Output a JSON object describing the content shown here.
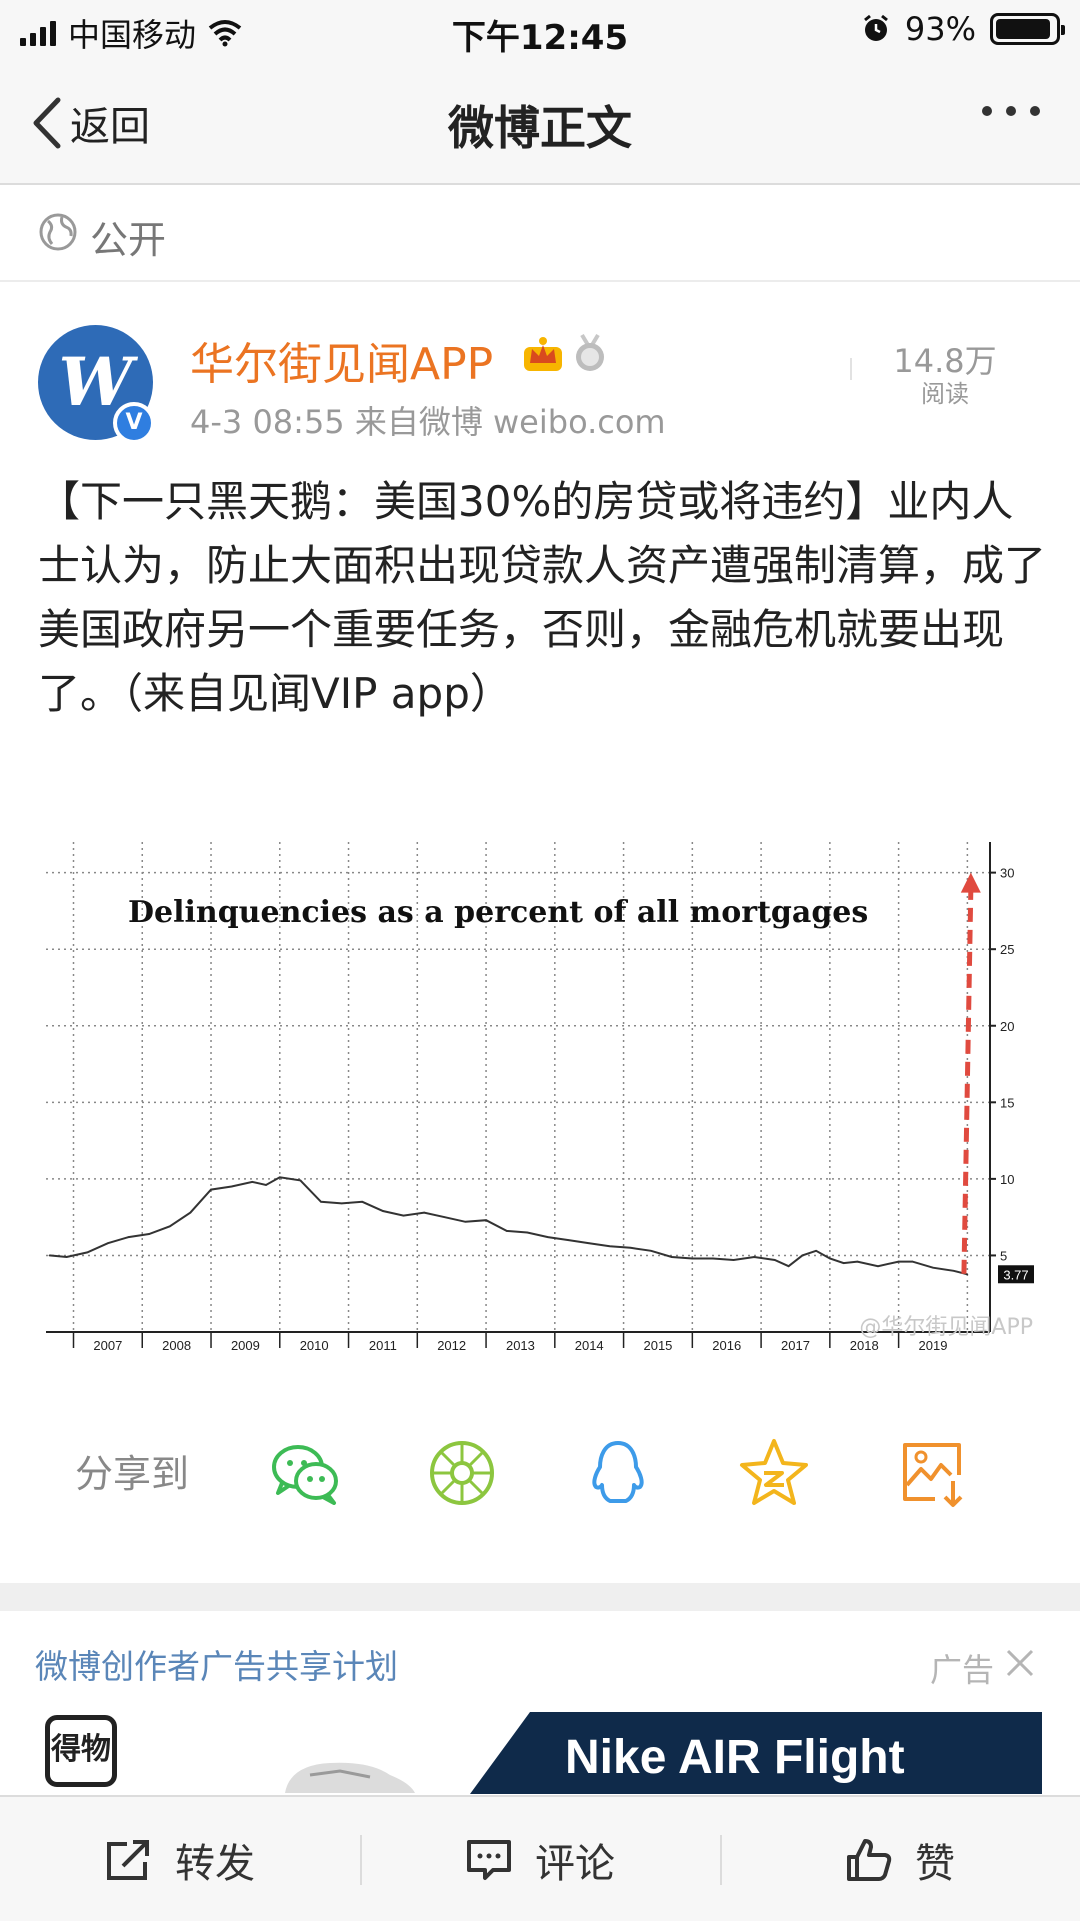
{
  "status_bar": {
    "carrier": "中国移动",
    "time": "下午12:45",
    "battery_text": "93%",
    "battery_level": 0.93
  },
  "nav": {
    "back_label": "返回",
    "title": "微博正文"
  },
  "post": {
    "visibility": "公开",
    "author": "华尔街见闻APP",
    "avatar_text": "W",
    "meta": "4-3 08:55  来自微博 weibo.com",
    "read_count": "14.8万",
    "read_label": "阅读",
    "text": "【下一只黑天鹅：美国30%的房贷或将违约】业内人士认为，防止大面积出现贷款人资产遭强制清算，成了美国政府另一个重要任务，否则，金融危机就要出现了。（来自见闻VIP app）",
    "watermark": "@华尔街见闻APP"
  },
  "chart_data": {
    "type": "line",
    "title": "Delinquencies as a percent of  all mortgages",
    "x_tick_labels": [
      "2007",
      "2008",
      "2009",
      "2010",
      "2011",
      "2012",
      "2013",
      "2014",
      "2015",
      "2016",
      "2017",
      "2018",
      "2019"
    ],
    "y_tick_labels": [
      "5",
      "10",
      "15",
      "20",
      "25",
      "30"
    ],
    "ylim": [
      0,
      32
    ],
    "xlim": [
      2006.6,
      2020.3
    ],
    "grid": true,
    "series": [
      {
        "name": "",
        "x": [
          2006.65,
          2006.9,
          2007.2,
          2007.5,
          2007.8,
          2008.1,
          2008.4,
          2008.7,
          2009.0,
          2009.3,
          2009.6,
          2009.8,
          2010.0,
          2010.3,
          2010.6,
          2010.9,
          2011.2,
          2011.5,
          2011.8,
          2012.1,
          2012.4,
          2012.7,
          2013.0,
          2013.3,
          2013.6,
          2013.9,
          2014.2,
          2014.5,
          2014.8,
          2015.1,
          2015.4,
          2015.7,
          2016.0,
          2016.3,
          2016.6,
          2016.9,
          2017.2,
          2017.4,
          2017.6,
          2017.8,
          2018.0,
          2018.2,
          2018.4,
          2018.7,
          2019.0,
          2019.2,
          2019.5,
          2019.8,
          2020.0
        ],
        "y": [
          5.0,
          4.9,
          5.2,
          5.8,
          6.2,
          6.4,
          6.9,
          7.8,
          9.3,
          9.5,
          9.8,
          9.6,
          10.1,
          9.9,
          8.5,
          8.4,
          8.5,
          7.9,
          7.6,
          7.8,
          7.5,
          7.2,
          7.3,
          6.6,
          6.5,
          6.2,
          6.0,
          5.8,
          5.6,
          5.5,
          5.3,
          4.9,
          4.8,
          4.8,
          4.7,
          4.9,
          4.7,
          4.3,
          5.0,
          5.3,
          4.8,
          4.5,
          4.6,
          4.3,
          4.6,
          4.6,
          4.2,
          4.0,
          3.77
        ]
      }
    ],
    "current_value_label": "3.77",
    "projection": {
      "from": [
        2019.95,
        3.8
      ],
      "to": [
        2020.05,
        30.0
      ]
    },
    "colors": {
      "line": "#333333",
      "projection": "#e04a3f",
      "grid": "#888888"
    }
  },
  "share": {
    "label": "分享到",
    "targets": [
      {
        "icon": "wechat-icon",
        "color": "#3dbb55"
      },
      {
        "icon": "moments-icon",
        "color": "#8cc63f"
      },
      {
        "icon": "qq-icon",
        "color": "#3d9be9"
      },
      {
        "icon": "qzone-icon",
        "color": "#f3b51c"
      },
      {
        "icon": "save-image-icon",
        "color": "#f0912d"
      }
    ]
  },
  "ad": {
    "title": "微博创作者广告共享计划",
    "tag": "广告",
    "logo_text": "得物",
    "banner_text": "Nike AIR Flight"
  },
  "actions": {
    "repost": "转发",
    "comment": "评论",
    "like": "赞"
  },
  "colors": {
    "author": "#eb7422",
    "ad_title": "#5a86b8",
    "avatar": "#2e6bb7"
  }
}
